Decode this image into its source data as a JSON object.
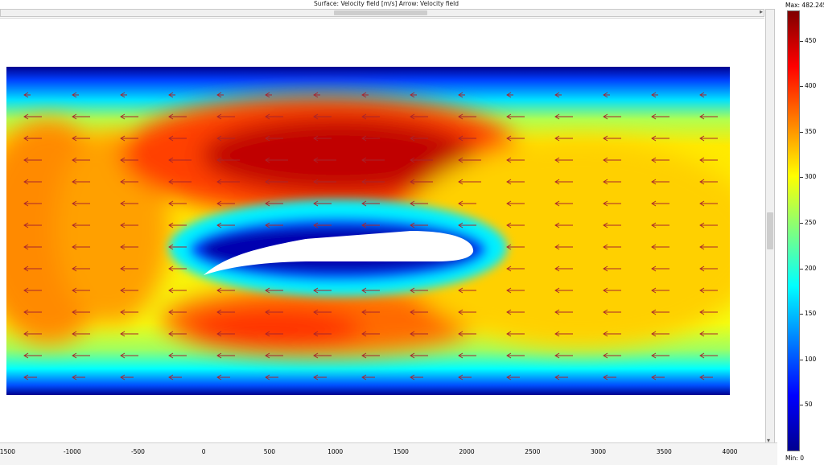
{
  "header": {
    "title": "Surface: Velocity field [m/s]   Arrow: Velocity field"
  },
  "colorbar": {
    "max_label": "Max: 482.245",
    "min_label": "Min: 0",
    "min": 0,
    "max": 482.245,
    "ticks": [
      "450",
      "400",
      "350",
      "300",
      "250",
      "200",
      "150",
      "100",
      "50"
    ],
    "tick_values": [
      450,
      400,
      350,
      300,
      250,
      200,
      150,
      100,
      50
    ],
    "colormap": [
      "#00008f",
      "#0000ff",
      "#007fff",
      "#00ffff",
      "#7fff7f",
      "#ffff00",
      "#ff7f00",
      "#ff0000",
      "#7f0000"
    ]
  },
  "chart_data": {
    "type": "heatmap",
    "title": "Surface: Velocity field [m/s]   Arrow: Velocity field",
    "xlim": [
      -1500,
      4000
    ],
    "x_ticks": [
      "-1500",
      "-1000",
      "-500",
      "0",
      "500",
      "1000",
      "1500",
      "2000",
      "2500",
      "3000",
      "3500",
      "4000"
    ],
    "x_tick_values": [
      -1500,
      -1000,
      -500,
      0,
      500,
      1000,
      1500,
      2000,
      2500,
      3000,
      3500,
      4000
    ],
    "domain_x": [
      -1500,
      4000
    ],
    "airfoil_x": [
      0,
      2050
    ],
    "arrow_color": "#a8242c",
    "arrow_direction": "left",
    "field_description": "velocity magnitude around airfoil, flow right-to-left",
    "regions": [
      {
        "name": "upper high-speed zone",
        "x": [
          0,
          2000
        ],
        "value": 470
      },
      {
        "name": "lower high-speed zone",
        "x": [
          -200,
          1900
        ],
        "value": 390
      },
      {
        "name": "left inflow",
        "x": [
          -1500,
          -500
        ],
        "value": 370
      },
      {
        "name": "wake",
        "x": [
          2000,
          4000
        ],
        "value": 300
      },
      {
        "name": "top boundary",
        "x": [
          -1500,
          4000
        ],
        "value": 80
      },
      {
        "name": "bottom boundary",
        "x": [
          -1500,
          4000
        ],
        "value": 60
      },
      {
        "name": "airfoil surface",
        "x": [
          0,
          2050
        ],
        "value": 40
      }
    ]
  }
}
